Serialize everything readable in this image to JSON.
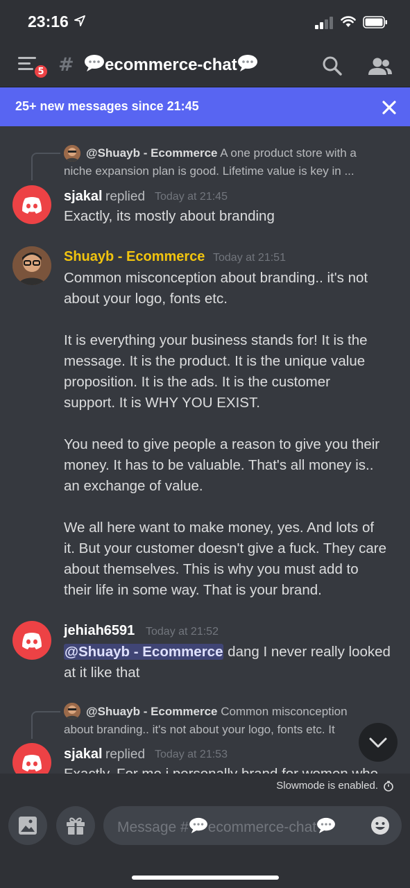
{
  "status_bar": {
    "time": "23:16"
  },
  "header": {
    "notification_count": "5",
    "channel_name": "ecommerce-chat"
  },
  "banner": {
    "text": "25+ new messages since 21:45"
  },
  "messages": [
    {
      "reply_to": {
        "author": "@Shuayb - Ecommerce",
        "line1": "A one product store with a",
        "line2": "niche expansion plan is good. Lifetime value is key in ..."
      },
      "author": "sjakal",
      "replied_label": "replied",
      "timestamp": "Today at 21:45",
      "author_color": "#ffffff",
      "text": [
        "Exactly, its mostly about branding"
      ]
    },
    {
      "author": "Shuayb - Ecommerce",
      "timestamp": "Today at 21:51",
      "author_color": "#f1c40f",
      "paragraphs": [
        [
          "Common misconception about branding.. it's not",
          "about your logo, fonts etc."
        ],
        [
          "It is everything your business stands for! It is the",
          "message. It is the product. It is the unique value",
          "proposition. It is the ads. It is the customer",
          "support. It is WHY YOU EXIST."
        ],
        [
          "You need to give people a reason to give you their",
          "money. It has to be valuable. That's all money is..",
          "an exchange of value."
        ],
        [
          "We all here want to make money, yes. And lots of",
          "it. But your customer doesn't give a fuck. They care",
          "about themselves. This is why you must add to",
          "their life in some way. That is your brand."
        ]
      ]
    },
    {
      "author": "jehiah6591",
      "timestamp": "Today at 21:52",
      "author_color": "#ffffff",
      "mention": "@Shuayb - Ecommerce",
      "line1_rest": " dang I never really looked",
      "line2": "at it like that"
    },
    {
      "reply_to": {
        "author": "@Shuayb - Ecommerce",
        "line1": "Common misconception",
        "line2": "about branding.. it's not about your logo, fonts etc.  It"
      },
      "author": "sjakal",
      "replied_label": "replied",
      "timestamp": "Today at 21:53",
      "author_color": "#ffffff",
      "text": [
        "Exactly. For me i personally brand for women who"
      ]
    }
  ],
  "slowmode": {
    "text": "Slowmode is enabled."
  },
  "composer": {
    "placeholder_prefix": "Message #",
    "placeholder_channel": "ecommerce-chat"
  },
  "colors": {
    "accent": "#5865f2",
    "discord_red": "#ed4245",
    "background": "#36393f",
    "highlight_name": "#f1c40f"
  }
}
